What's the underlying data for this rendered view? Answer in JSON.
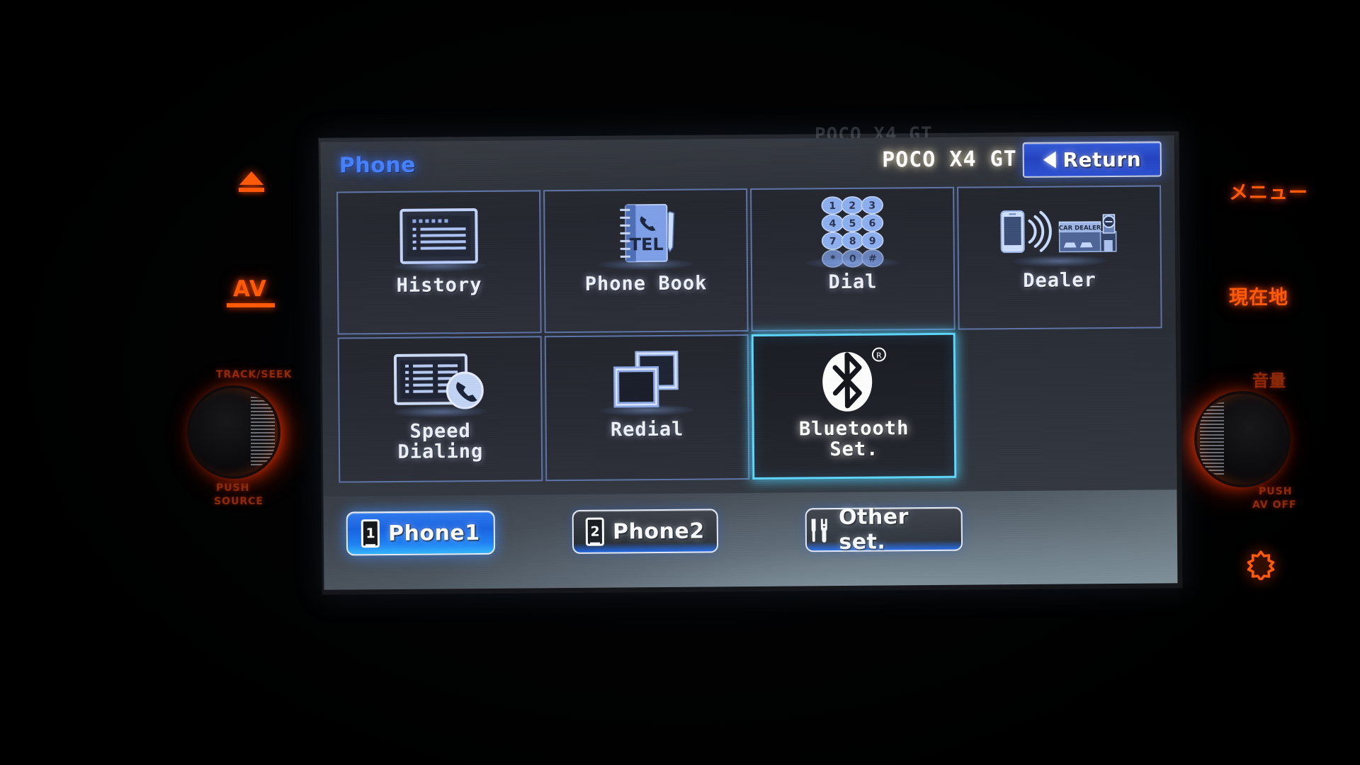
{
  "screen": {
    "header": {
      "title": "Phone",
      "device_name": "POCO X4 GT",
      "return_label": "Return",
      "title_color": "#3f7cff",
      "return_bg": "#2347cc"
    },
    "tiles": [
      {
        "label": "History",
        "icon": "history-list-icon",
        "selected": false
      },
      {
        "label": "Phone Book",
        "icon": "phonebook-tel-icon",
        "selected": false
      },
      {
        "label": "Dial",
        "icon": "keypad-icon",
        "selected": false
      },
      {
        "label": "Dealer",
        "icon": "car-dealer-icon",
        "selected": false
      },
      {
        "label": "Speed\nDialing",
        "icon": "speed-dial-icon",
        "selected": false
      },
      {
        "label": "Redial",
        "icon": "redial-frames-icon",
        "selected": false
      },
      {
        "label": "Bluetooth\nSet.",
        "icon": "bluetooth-icon",
        "selected": true
      }
    ],
    "tile_labels": {
      "history": "History",
      "phone_book": "Phone Book",
      "dial": "Dial",
      "dealer": "Dealer",
      "speed_dialing_line1": "Speed",
      "speed_dialing_line2": "Dialing",
      "redial": "Redial",
      "bluetooth_line1": "Bluetooth",
      "bluetooth_line2": "Set."
    },
    "phonebook_icon_text": "TEL",
    "dealer_icon_text": "CAR DEALER",
    "keypad_keys": [
      "1",
      "2",
      "3",
      "4",
      "5",
      "6",
      "7",
      "8",
      "9",
      "*",
      "0",
      "#"
    ],
    "bottom_bar": {
      "phone1_label": "Phone1",
      "phone1_badge": "1",
      "phone1_active": true,
      "phone2_label": "Phone2",
      "phone2_badge": "2",
      "phone2_active": false,
      "other_set_label": "Other set.",
      "active_color": "#1f82f5"
    },
    "bezel_text": "POCO X4 GT"
  },
  "dashboard": {
    "left": {
      "eject": "eject-icon",
      "av_label": "AV",
      "track_seek_label": "TRACK/SEEK",
      "push_label": "PUSH",
      "source_label": "SOURCE"
    },
    "right": {
      "menu_label": "メニュー",
      "current_location_label": "現在地",
      "volume_label": "音量",
      "push_label": "PUSH",
      "av_off_label": "AV OFF",
      "gear": "gear-icon"
    },
    "backlight_color": "#ff5a0a"
  }
}
